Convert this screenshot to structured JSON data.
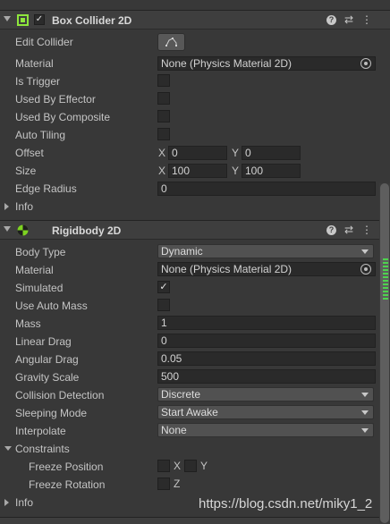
{
  "box_collider": {
    "title": "Box Collider 2D",
    "enabled": true,
    "rows": {
      "edit_collider": "Edit Collider",
      "material_label": "Material",
      "material_value": "None (Physics Material 2D)",
      "is_trigger": "Is Trigger",
      "used_by_effector": "Used By Effector",
      "used_by_composite": "Used By Composite",
      "auto_tiling": "Auto Tiling",
      "offset": "Offset",
      "offset_x": "0",
      "offset_y": "0",
      "size": "Size",
      "size_x": "100",
      "size_y": "100",
      "edge_radius": "Edge Radius",
      "edge_radius_value": "0",
      "info": "Info"
    }
  },
  "rigidbody": {
    "title": "Rigidbody 2D",
    "rows": {
      "body_type": "Body Type",
      "body_type_value": "Dynamic",
      "material_label": "Material",
      "material_value": "None (Physics Material 2D)",
      "simulated": "Simulated",
      "use_auto_mass": "Use Auto Mass",
      "mass": "Mass",
      "mass_value": "1",
      "linear_drag": "Linear Drag",
      "linear_drag_value": "0",
      "angular_drag": "Angular Drag",
      "angular_drag_value": "0.05",
      "gravity_scale": "Gravity Scale",
      "gravity_scale_value": "500",
      "collision_detection": "Collision Detection",
      "collision_detection_value": "Discrete",
      "sleeping_mode": "Sleeping Mode",
      "sleeping_mode_value": "Start Awake",
      "interpolate": "Interpolate",
      "interpolate_value": "None",
      "constraints": "Constraints",
      "freeze_position": "Freeze Position",
      "freeze_rotation": "Freeze Rotation",
      "info": "Info"
    }
  },
  "axis": {
    "x": "X",
    "y": "Y",
    "z": "Z"
  },
  "icons": {
    "checkmark": "✓",
    "help": "?",
    "presets": "⇄",
    "menu": "⋮"
  },
  "watermark": "https://blog.csdn.net/miky1_2",
  "colors": {
    "panel_bg": "#383838",
    "collider_green": "#8ee63c",
    "rigidbody_green": "#7ed321"
  }
}
